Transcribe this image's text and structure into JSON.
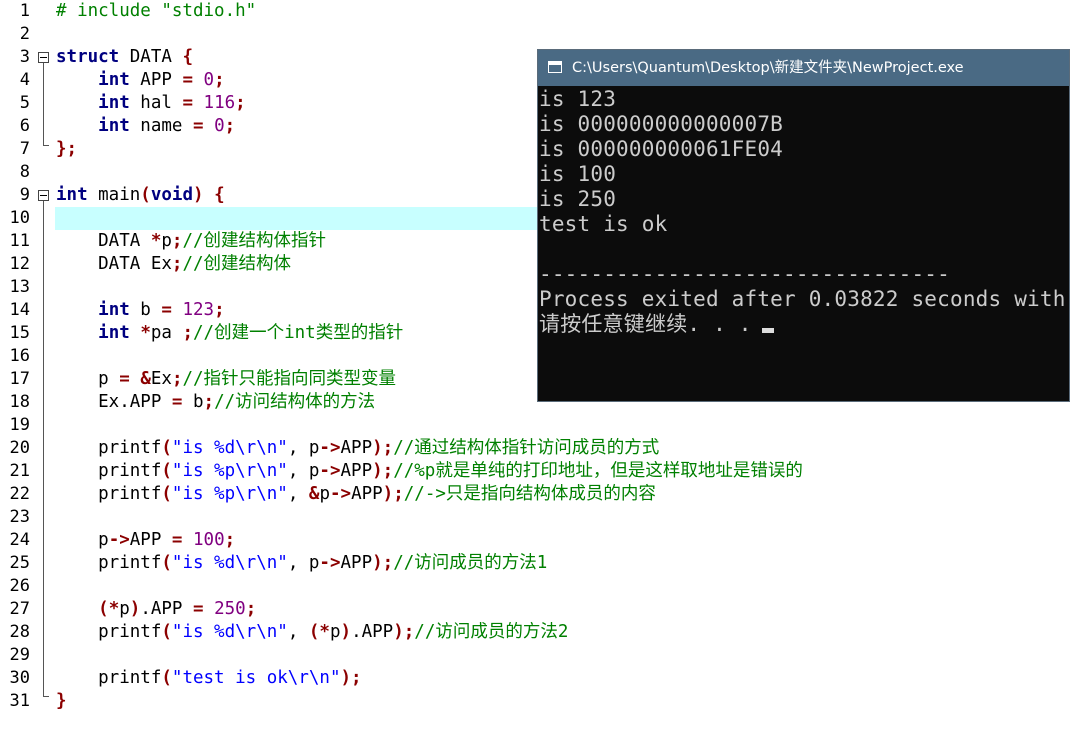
{
  "editor": {
    "highlighted_line": 10,
    "lines": [
      {
        "n": "1",
        "parts": [
          {
            "t": "# include \"stdio.h\"",
            "c": "pp"
          }
        ]
      },
      {
        "n": "2",
        "parts": []
      },
      {
        "n": "3",
        "parts": [
          {
            "t": "struct",
            "c": "kw"
          },
          {
            "t": " DATA ",
            "c": ""
          },
          {
            "t": "{",
            "c": "sym"
          }
        ]
      },
      {
        "n": "4",
        "parts": [
          {
            "t": "    ",
            "c": ""
          },
          {
            "t": "int",
            "c": "kw"
          },
          {
            "t": " APP ",
            "c": ""
          },
          {
            "t": "=",
            "c": "sym"
          },
          {
            "t": " ",
            "c": ""
          },
          {
            "t": "0",
            "c": "num"
          },
          {
            "t": ";",
            "c": "sym"
          }
        ]
      },
      {
        "n": "5",
        "parts": [
          {
            "t": "    ",
            "c": ""
          },
          {
            "t": "int",
            "c": "kw"
          },
          {
            "t": " hal ",
            "c": ""
          },
          {
            "t": "=",
            "c": "sym"
          },
          {
            "t": " ",
            "c": ""
          },
          {
            "t": "116",
            "c": "num"
          },
          {
            "t": ";",
            "c": "sym"
          }
        ]
      },
      {
        "n": "6",
        "parts": [
          {
            "t": "    ",
            "c": ""
          },
          {
            "t": "int",
            "c": "kw"
          },
          {
            "t": " name ",
            "c": ""
          },
          {
            "t": "=",
            "c": "sym"
          },
          {
            "t": " ",
            "c": ""
          },
          {
            "t": "0",
            "c": "num"
          },
          {
            "t": ";",
            "c": "sym"
          }
        ]
      },
      {
        "n": "7",
        "parts": [
          {
            "t": "};",
            "c": "sym"
          }
        ]
      },
      {
        "n": "8",
        "parts": []
      },
      {
        "n": "9",
        "parts": [
          {
            "t": "int",
            "c": "kw"
          },
          {
            "t": " main",
            "c": ""
          },
          {
            "t": "(",
            "c": "sym"
          },
          {
            "t": "void",
            "c": "kw"
          },
          {
            "t": ")",
            "c": "sym"
          },
          {
            "t": " ",
            "c": ""
          },
          {
            "t": "{",
            "c": "sym"
          }
        ]
      },
      {
        "n": "10",
        "parts": []
      },
      {
        "n": "11",
        "parts": [
          {
            "t": "    DATA ",
            "c": ""
          },
          {
            "t": "*",
            "c": "sym"
          },
          {
            "t": "p",
            "c": ""
          },
          {
            "t": ";",
            "c": "sym"
          },
          {
            "t": "//创建结构体指针",
            "c": "cmt"
          }
        ]
      },
      {
        "n": "12",
        "parts": [
          {
            "t": "    DATA Ex",
            "c": ""
          },
          {
            "t": ";",
            "c": "sym"
          },
          {
            "t": "//创建结构体",
            "c": "cmt"
          }
        ]
      },
      {
        "n": "13",
        "parts": []
      },
      {
        "n": "14",
        "parts": [
          {
            "t": "    ",
            "c": ""
          },
          {
            "t": "int",
            "c": "kw"
          },
          {
            "t": " b ",
            "c": ""
          },
          {
            "t": "=",
            "c": "sym"
          },
          {
            "t": " ",
            "c": ""
          },
          {
            "t": "123",
            "c": "num"
          },
          {
            "t": ";",
            "c": "sym"
          }
        ]
      },
      {
        "n": "15",
        "parts": [
          {
            "t": "    ",
            "c": ""
          },
          {
            "t": "int",
            "c": "kw"
          },
          {
            "t": " ",
            "c": ""
          },
          {
            "t": "*",
            "c": "sym"
          },
          {
            "t": "pa ",
            "c": ""
          },
          {
            "t": ";",
            "c": "sym"
          },
          {
            "t": "//创建一个int类型的指针",
            "c": "cmt"
          }
        ]
      },
      {
        "n": "16",
        "parts": []
      },
      {
        "n": "17",
        "parts": [
          {
            "t": "    p ",
            "c": ""
          },
          {
            "t": "=",
            "c": "sym"
          },
          {
            "t": " ",
            "c": ""
          },
          {
            "t": "&",
            "c": "sym"
          },
          {
            "t": "Ex",
            "c": ""
          },
          {
            "t": ";",
            "c": "sym"
          },
          {
            "t": "//指针只能指向同类型变量",
            "c": "cmt"
          }
        ]
      },
      {
        "n": "18",
        "parts": [
          {
            "t": "    Ex.APP ",
            "c": ""
          },
          {
            "t": "=",
            "c": "sym"
          },
          {
            "t": " b",
            "c": ""
          },
          {
            "t": ";",
            "c": "sym"
          },
          {
            "t": "//访问结构体的方法",
            "c": "cmt"
          }
        ]
      },
      {
        "n": "19",
        "parts": []
      },
      {
        "n": "20",
        "parts": [
          {
            "t": "    printf",
            "c": ""
          },
          {
            "t": "(",
            "c": "sym"
          },
          {
            "t": "\"is %d\\r\\n\"",
            "c": "str"
          },
          {
            "t": ", p",
            "c": ""
          },
          {
            "t": "->",
            "c": "sym"
          },
          {
            "t": "APP",
            "c": ""
          },
          {
            "t": ");",
            "c": "sym"
          },
          {
            "t": "//通过结构体指针访问成员的方式",
            "c": "cmt"
          }
        ]
      },
      {
        "n": "21",
        "parts": [
          {
            "t": "    printf",
            "c": ""
          },
          {
            "t": "(",
            "c": "sym"
          },
          {
            "t": "\"is %p\\r\\n\"",
            "c": "str"
          },
          {
            "t": ", p",
            "c": ""
          },
          {
            "t": "->",
            "c": "sym"
          },
          {
            "t": "APP",
            "c": ""
          },
          {
            "t": ");",
            "c": "sym"
          },
          {
            "t": "//%p就是单纯的打印地址，但是这样取地址是错误的",
            "c": "cmt"
          }
        ]
      },
      {
        "n": "22",
        "parts": [
          {
            "t": "    printf",
            "c": ""
          },
          {
            "t": "(",
            "c": "sym"
          },
          {
            "t": "\"is %p\\r\\n\"",
            "c": "str"
          },
          {
            "t": ", ",
            "c": ""
          },
          {
            "t": "&",
            "c": "sym"
          },
          {
            "t": "p",
            "c": ""
          },
          {
            "t": "->",
            "c": "sym"
          },
          {
            "t": "APP",
            "c": ""
          },
          {
            "t": ");",
            "c": "sym"
          },
          {
            "t": "//->只是指向结构体成员的内容",
            "c": "cmt"
          }
        ]
      },
      {
        "n": "23",
        "parts": []
      },
      {
        "n": "24",
        "parts": [
          {
            "t": "    p",
            "c": ""
          },
          {
            "t": "->",
            "c": "sym"
          },
          {
            "t": "APP ",
            "c": ""
          },
          {
            "t": "=",
            "c": "sym"
          },
          {
            "t": " ",
            "c": ""
          },
          {
            "t": "100",
            "c": "num"
          },
          {
            "t": ";",
            "c": "sym"
          }
        ]
      },
      {
        "n": "25",
        "parts": [
          {
            "t": "    printf",
            "c": ""
          },
          {
            "t": "(",
            "c": "sym"
          },
          {
            "t": "\"is %d\\r\\n\"",
            "c": "str"
          },
          {
            "t": ", p",
            "c": ""
          },
          {
            "t": "->",
            "c": "sym"
          },
          {
            "t": "APP",
            "c": ""
          },
          {
            "t": ");",
            "c": "sym"
          },
          {
            "t": "//访问成员的方法1",
            "c": "cmt"
          }
        ]
      },
      {
        "n": "26",
        "parts": []
      },
      {
        "n": "27",
        "parts": [
          {
            "t": "    ",
            "c": ""
          },
          {
            "t": "(*",
            "c": "sym"
          },
          {
            "t": "p",
            "c": ""
          },
          {
            "t": ")",
            "c": "sym"
          },
          {
            "t": ".APP ",
            "c": ""
          },
          {
            "t": "=",
            "c": "sym"
          },
          {
            "t": " ",
            "c": ""
          },
          {
            "t": "250",
            "c": "num"
          },
          {
            "t": ";",
            "c": "sym"
          }
        ]
      },
      {
        "n": "28",
        "parts": [
          {
            "t": "    printf",
            "c": ""
          },
          {
            "t": "(",
            "c": "sym"
          },
          {
            "t": "\"is %d\\r\\n\"",
            "c": "str"
          },
          {
            "t": ", ",
            "c": ""
          },
          {
            "t": "(*",
            "c": "sym"
          },
          {
            "t": "p",
            "c": ""
          },
          {
            "t": ")",
            "c": "sym"
          },
          {
            "t": ".APP",
            "c": ""
          },
          {
            "t": ");",
            "c": "sym"
          },
          {
            "t": "//访问成员的方法2",
            "c": "cmt"
          }
        ]
      },
      {
        "n": "29",
        "parts": []
      },
      {
        "n": "30",
        "parts": [
          {
            "t": "    printf",
            "c": ""
          },
          {
            "t": "(",
            "c": "sym"
          },
          {
            "t": "\"test is ok\\r\\n\"",
            "c": "str"
          },
          {
            "t": ");",
            "c": "sym"
          }
        ]
      },
      {
        "n": "31",
        "parts": [
          {
            "t": "}",
            "c": "sym"
          }
        ]
      }
    ]
  },
  "console": {
    "title": "C:\\Users\\Quantum\\Desktop\\新建文件夹\\NewProject.exe",
    "lines": [
      "is 123",
      "is 000000000000007B",
      "is 000000000061FE04",
      "is 100",
      "is 250",
      "test is ok",
      "",
      "--------------------------------",
      "Process exited after 0.03822 seconds with",
      "请按任意键继续. . ."
    ]
  },
  "colors": {
    "keyword": "#000080",
    "number": "#800080",
    "string": "#0000ff",
    "comment": "#008000",
    "symbol": "#8b0000",
    "current_line": "#c8ffff",
    "console_bg": "#0c0c0c",
    "console_title_bg": "#4a6a84"
  }
}
